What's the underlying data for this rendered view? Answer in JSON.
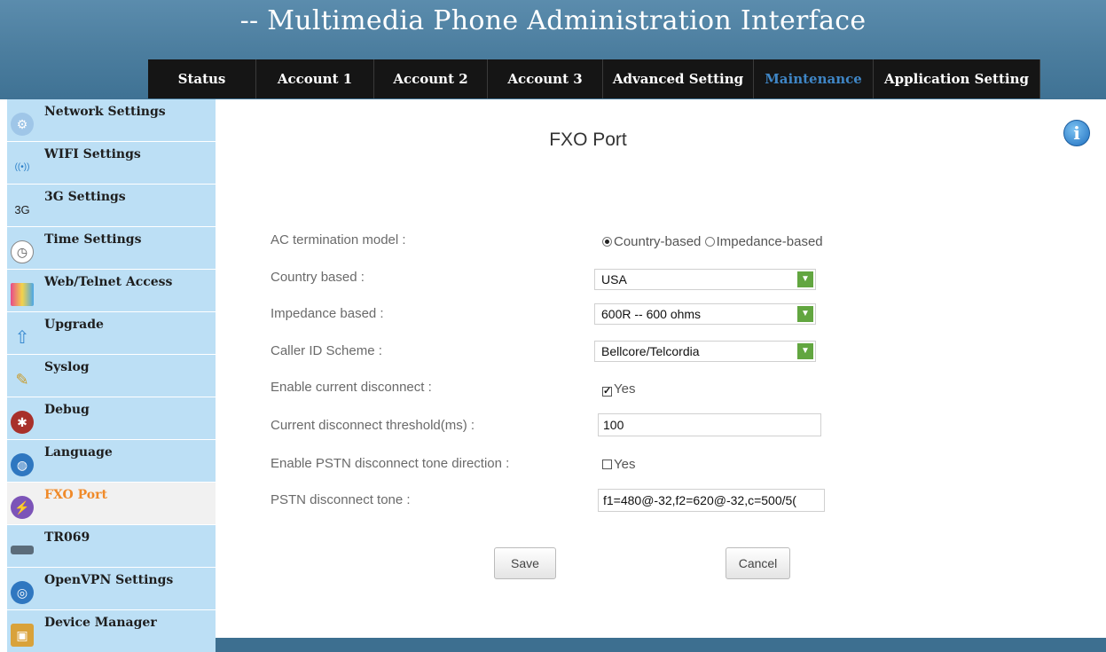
{
  "app": {
    "title": "-- Multimedia Phone Administration Interface"
  },
  "nav": {
    "tabs": [
      {
        "label": "Status",
        "active": false
      },
      {
        "label": "Account 1",
        "active": false
      },
      {
        "label": "Account 2",
        "active": false
      },
      {
        "label": "Account 3",
        "active": false
      },
      {
        "label": "Advanced Setting",
        "active": false
      },
      {
        "label": "Maintenance",
        "active": true
      },
      {
        "label": "Application Setting",
        "active": false
      }
    ]
  },
  "sidebar": {
    "items": [
      {
        "label": "Network Settings",
        "icon": "network-settings-icon"
      },
      {
        "label": "WIFI Settings",
        "icon": "wifi-icon"
      },
      {
        "label": "3G Settings",
        "icon": "3g-icon"
      },
      {
        "label": "Time Settings",
        "icon": "clock-icon"
      },
      {
        "label": "Web/Telnet Access",
        "icon": "web-telnet-icon"
      },
      {
        "label": "Upgrade",
        "icon": "upgrade-arrow-icon"
      },
      {
        "label": "Syslog",
        "icon": "syslog-notepad-icon"
      },
      {
        "label": "Debug",
        "icon": "bug-icon"
      },
      {
        "label": "Language",
        "icon": "globe-icon"
      },
      {
        "label": "FXO Port",
        "icon": "fxo-port-icon",
        "active": true
      },
      {
        "label": "TR069",
        "icon": "tr069-device-icon"
      },
      {
        "label": "OpenVPN Settings",
        "icon": "openvpn-globe-icon"
      },
      {
        "label": "Device Manager",
        "icon": "device-manager-icon"
      }
    ],
    "icon_glyphs": [
      "⚙",
      "((•))",
      "3G",
      "◷",
      "▤",
      "⇧",
      "✎",
      "✱",
      "◍",
      "⚡",
      "▭",
      "◎",
      "▣"
    ],
    "icon_colors": [
      "#3a7cc4",
      "#ffffff",
      "#ffffff",
      "#ffffff",
      "#e6d24a",
      "#ffffff",
      "#ffffff",
      "#ffffff",
      "#2f77c0",
      "#7c54b8",
      "#ffffff",
      "#2f77c0",
      "#d9a23a"
    ]
  },
  "main": {
    "title": "FXO Port",
    "info_icon": "info-icon",
    "fields": {
      "ac_termination_label": "AC termination model :",
      "ac_termination_options": [
        "Country-based",
        "Impedance-based"
      ],
      "ac_termination_selected": "Country-based",
      "country_label": "Country based :",
      "country_value": "USA",
      "impedance_label": "Impedance based :",
      "impedance_value": "600R -- 600 ohms",
      "callerid_label": "Caller ID Scheme :",
      "callerid_value": "Bellcore/Telcordia",
      "current_disconnect_label": "Enable current disconnect :",
      "current_disconnect_checked": true,
      "current_disconnect_option": "Yes",
      "threshold_label": "Current disconnect threshold(ms) :",
      "threshold_value": "100",
      "pstn_tone_direction_label": "Enable PSTN disconnect tone direction :",
      "pstn_tone_direction_checked": false,
      "pstn_tone_direction_option": "Yes",
      "pstn_tone_label": "PSTN disconnect tone :",
      "pstn_tone_value": "f1=480@-32,f2=620@-32,c=500/5("
    },
    "buttons": {
      "save": "Save",
      "cancel": "Cancel"
    }
  },
  "colors": {
    "header": "#4c7e9f",
    "nav_bg": "#151515",
    "nav_active": "#3f86c6",
    "sidebar_bg": "#bcdff5",
    "sidebar_active_label": "#f08a29",
    "select_arrow": "#62a640"
  }
}
